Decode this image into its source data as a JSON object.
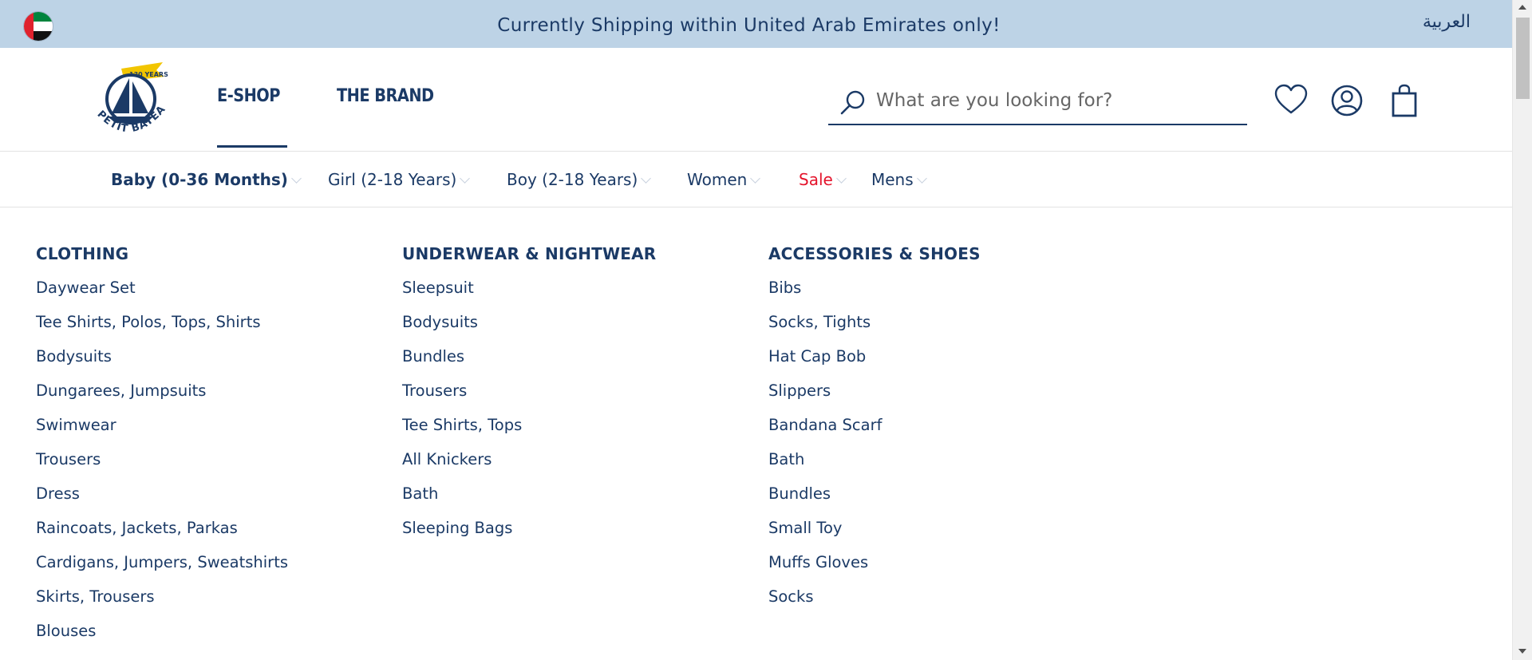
{
  "topbar": {
    "flag_icon": "uae-flag-icon",
    "message": "Currently Shipping within United Arab Emirates only!",
    "language_link": "العربية",
    "background": "#bdd3e6"
  },
  "header": {
    "logo_text": "PETIT BATEAU",
    "logo_badge": "130 YEARS",
    "nav": [
      {
        "label": "E-SHOP",
        "active": true
      },
      {
        "label": "THE BRAND",
        "active": false
      }
    ],
    "search": {
      "placeholder": "What are you looking for?",
      "value": ""
    },
    "icons": [
      "heart-icon",
      "user-icon",
      "shopping-bag-icon"
    ]
  },
  "categories": [
    {
      "label": "Baby (0-36 Months)",
      "active": true
    },
    {
      "label": "Girl (2-18 Years)",
      "active": false
    },
    {
      "label": "Boy (2-18 Years)",
      "active": false
    },
    {
      "label": "Women",
      "active": false
    },
    {
      "label": "Sale",
      "active": false,
      "color": "#e4132b"
    },
    {
      "label": "Mens",
      "active": false
    }
  ],
  "menu": {
    "columns": [
      {
        "heading": "CLOTHING",
        "items": [
          "Daywear Set",
          "Tee Shirts, Polos, Tops, Shirts",
          "Bodysuits",
          "Dungarees, Jumpsuits",
          "Swimwear",
          "Trousers",
          "Dress",
          "Raincoats, Jackets, Parkas",
          "Cardigans, Jumpers, Sweatshirts",
          "Skirts, Trousers",
          "Blouses"
        ]
      },
      {
        "heading": "UNDERWEAR & NIGHTWEAR",
        "items": [
          "Sleepsuit",
          "Bodysuits",
          "Bundles",
          "Trousers",
          "Tee Shirts, Tops",
          "All Knickers",
          "Bath",
          "Sleeping Bags"
        ]
      },
      {
        "heading": "ACCESSORIES & SHOES",
        "items": [
          "Bibs",
          "Socks, Tights",
          "Hat Cap Bob",
          "Slippers",
          "Bandana Scarf",
          "Bath",
          "Bundles",
          "Small Toy",
          "Muffs Gloves",
          "Socks"
        ]
      }
    ]
  },
  "colors": {
    "brand": "#1b3a66",
    "sale": "#e4132b",
    "accent_yellow": "#f2c500"
  }
}
